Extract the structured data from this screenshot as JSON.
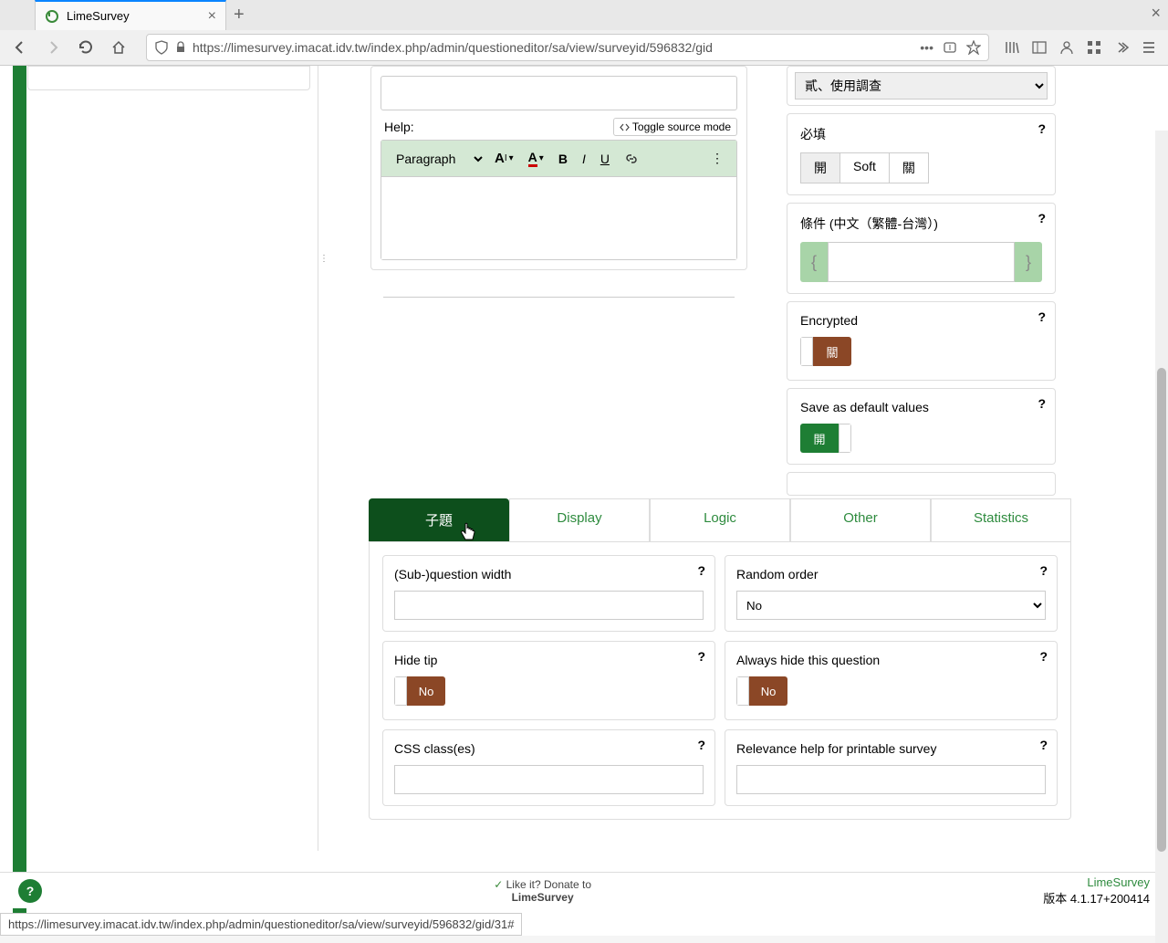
{
  "browser": {
    "tab_title": "LimeSurvey",
    "url": "https://limesurvey.imacat.idv.tw/index.php/admin/questioneditor/sa/view/surveyid/596832/gid"
  },
  "editor": {
    "help_label": "Help:",
    "toggle_source": "Toggle source mode",
    "paragraph": "Paragraph"
  },
  "settings": {
    "group_select": "貳、使用調查",
    "required_label": "必填",
    "required_on": "開",
    "required_soft": "Soft",
    "required_off": "關",
    "condition_label": "條件 (中文（繁體-台灣）)",
    "encrypted_label": "Encrypted",
    "encrypted_state": "關",
    "save_default_label": "Save as default values",
    "save_default_state": "開"
  },
  "tabs": {
    "items": [
      "子題",
      "Display",
      "Logic",
      "Other",
      "Statistics"
    ]
  },
  "options": {
    "subq_width": "(Sub-)question width",
    "random_order": "Random order",
    "random_order_val": "No",
    "hide_tip": "Hide tip",
    "hide_tip_val": "No",
    "always_hide": "Always hide this question",
    "always_hide_val": "No",
    "css_classes": "CSS class(es)",
    "relevance_help": "Relevance help for printable survey"
  },
  "footer": {
    "donate": "Like it? Donate to",
    "limesurvey": "LimeSurvey",
    "version": "版本 4.1.17+200414"
  },
  "status_url": "https://limesurvey.imacat.idv.tw/index.php/admin/questioneditor/sa/view/surveyid/596832/gid/31#"
}
